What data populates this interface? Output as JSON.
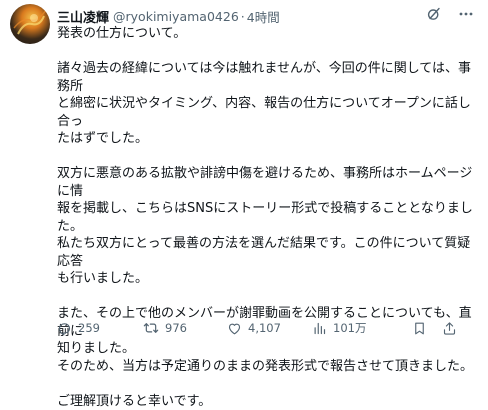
{
  "author": {
    "display_name": "三山凌輝",
    "handle": "@ryokimiyama0426",
    "separator": "·",
    "time": "4時間"
  },
  "top_icons": [
    "grok-icon",
    "more-icon"
  ],
  "tweet": {
    "paragraphs": [
      "発表の仕方について。",
      "諸々過去の経緯については今は触れませんが、今回の件に関しては、事務所\nと綿密に状況やタイミング、内容、報告の仕方についてオープンに話し合っ\nたはずでした。",
      "双方に悪意のある拡散や誹謗中傷を避けるため、事務所はホームページに情\n報を掲載し、こちらはSNSにストーリー形式で投稿することとなりました。\n私たち双方にとって最善の方法を選んだ結果です。この件について質疑応答\nも行いました。",
      "また、その上で他のメンバーが謝罪動画を公開することについても、直前に\n知りました。\nそのため、当方は予定通りのままの発表形式で報告させて頂きました。",
      "ご理解頂けると幸いです。"
    ]
  },
  "actions": {
    "replies": "259",
    "reposts": "976",
    "likes": "4,107",
    "views": "101万"
  },
  "colors": {
    "text": "#0f1419",
    "secondary": "#536471",
    "background": "#ffffff"
  }
}
